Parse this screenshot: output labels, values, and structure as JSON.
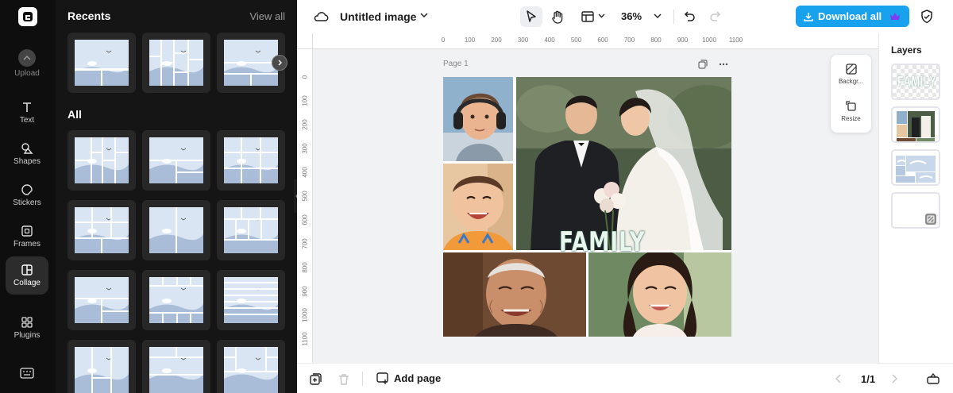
{
  "rail": {
    "items": [
      {
        "label": "Upload",
        "icon": "upload-icon"
      },
      {
        "label": "Text",
        "icon": "text-icon"
      },
      {
        "label": "Shapes",
        "icon": "shapes-icon"
      },
      {
        "label": "Stickers",
        "icon": "stickers-icon"
      },
      {
        "label": "Frames",
        "icon": "frames-icon"
      },
      {
        "label": "Collage",
        "icon": "collage-icon",
        "active": true
      },
      {
        "label": "Plugins",
        "icon": "plugins-icon"
      }
    ]
  },
  "panel": {
    "recents_title": "Recents",
    "view_all": "View all",
    "all_title": "All"
  },
  "topbar": {
    "title": "Untitled image",
    "zoom": "36%",
    "download_label": "Download all"
  },
  "canvas": {
    "page_label": "Page 1",
    "family_text": "FAMILY",
    "ruler_top": [
      "0",
      "100",
      "200",
      "300",
      "400",
      "500",
      "600",
      "700",
      "800",
      "900",
      "1000",
      "1100"
    ],
    "ruler_left": [
      "0",
      "100",
      "200",
      "300",
      "400",
      "500",
      "600",
      "700",
      "800",
      "900",
      "1000",
      "1100"
    ],
    "float_panel": {
      "background": "Backgr...",
      "resize": "Resize"
    }
  },
  "layers": {
    "title": "Layers",
    "thumb_text": "FAMILY"
  },
  "bottombar": {
    "add_page": "Add page",
    "pager": "1/1"
  },
  "colors": {
    "accent": "#18a2ee",
    "rail_bg": "#0e0e0e",
    "panel_bg": "#151515",
    "canvas_bg": "#f1f2f4"
  }
}
